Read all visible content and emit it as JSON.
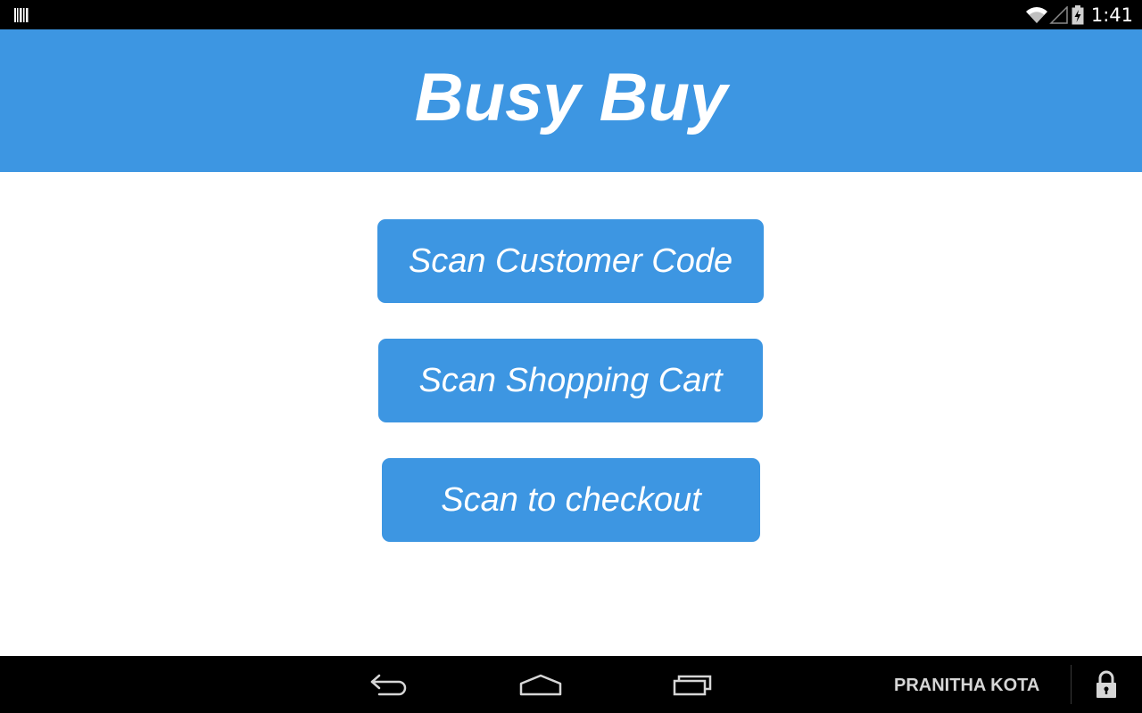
{
  "status_bar": {
    "time": "1:41",
    "icons": [
      "barcode-icon",
      "wifi-icon",
      "signal-icon",
      "battery-charging-icon"
    ]
  },
  "header": {
    "title": "Busy Buy"
  },
  "buttons": [
    {
      "label": "Scan Customer Code"
    },
    {
      "label": "Scan Shopping Cart"
    },
    {
      "label": "Scan to checkout"
    }
  ],
  "nav_bar": {
    "icons": [
      "back-icon",
      "home-icon",
      "recent-apps-icon",
      "lock-icon"
    ],
    "user_name": "PRANITHA KOTA"
  },
  "colors": {
    "accent": "#3d96e2",
    "background": "#ffffff",
    "system_bars": "#000000"
  }
}
